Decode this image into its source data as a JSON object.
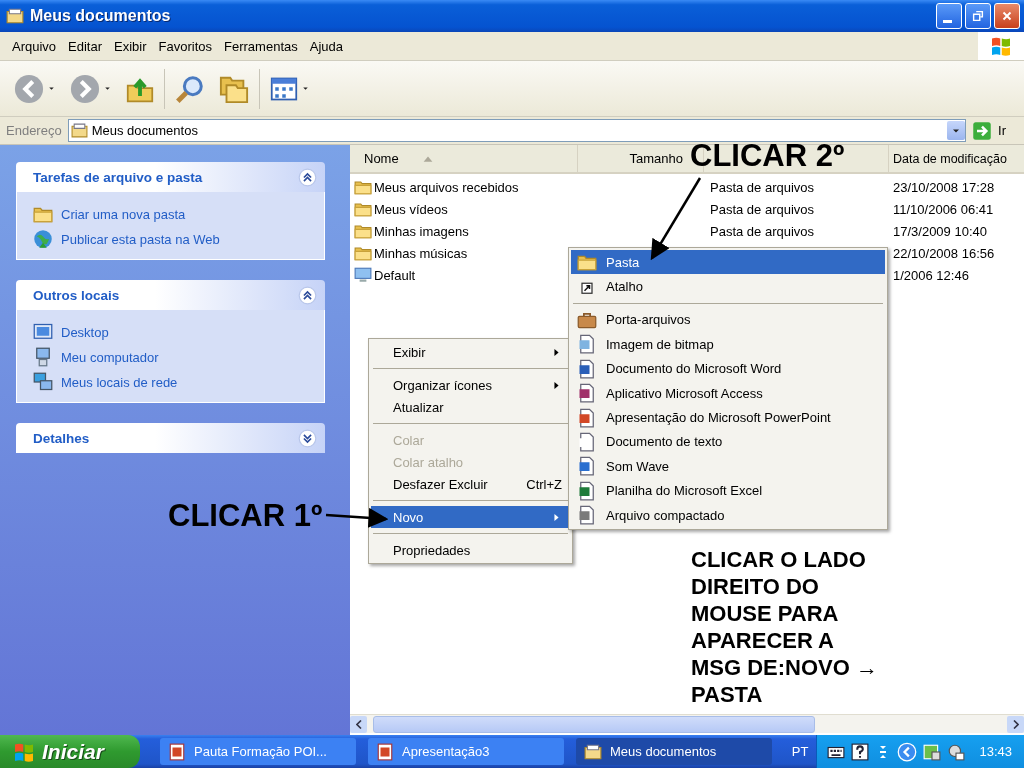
{
  "window": {
    "title": "Meus documentos"
  },
  "menu_bar": [
    "Arquivo",
    "Editar",
    "Exibir",
    "Favoritos",
    "Ferramentas",
    "Ajuda"
  ],
  "address_bar": {
    "label": "Endereço",
    "value": "Meus documentos",
    "go_button": "Ir"
  },
  "task_panes": [
    {
      "title": "Tarefas de arquivo e pasta",
      "expanded": true,
      "links": [
        "Criar uma nova pasta",
        "Publicar esta pasta na Web"
      ]
    },
    {
      "title": "Outros locais",
      "expanded": true,
      "links": [
        "Desktop",
        "Meu computador",
        "Meus locais de rede"
      ]
    },
    {
      "title": "Detalhes",
      "expanded": false
    }
  ],
  "file_list": {
    "columns": [
      {
        "label": "Nome",
        "sorted": true
      },
      {
        "label": "Tamanho",
        "sorted": false
      },
      {
        "label": "Data de modificação",
        "sorted": false
      }
    ],
    "rows": [
      {
        "name": "Meus arquivos recebidos",
        "type": "Pasta de arquivos",
        "modified": "23/10/2008 17:28"
      },
      {
        "name": "Meus vídeos",
        "type": "Pasta de arquivos",
        "modified": "11/10/2006 06:41"
      },
      {
        "name": "Minhas imagens",
        "type": "Pasta de arquivos",
        "modified": "17/3/2009 10:40"
      },
      {
        "name": "Minhas músicas",
        "modified": "22/10/2008 16:56"
      },
      {
        "name": "Default",
        "modified": "1/2006 12:46"
      }
    ]
  },
  "context_menu": [
    {
      "kind": "item",
      "label": "Exibir",
      "submenu": true,
      "disabled": false,
      "selected": false
    },
    {
      "kind": "separator"
    },
    {
      "kind": "item",
      "label": "Organizar ícones",
      "submenu": true,
      "disabled": false,
      "selected": false
    },
    {
      "kind": "item",
      "label": "Atualizar",
      "submenu": false,
      "disabled": false,
      "selected": false
    },
    {
      "kind": "separator"
    },
    {
      "kind": "item",
      "label": "Colar",
      "submenu": false,
      "disabled": true,
      "selected": false
    },
    {
      "kind": "item",
      "label": "Colar atalho",
      "submenu": false,
      "disabled": true,
      "selected": false
    },
    {
      "kind": "item",
      "label": "Desfazer Excluir",
      "shortcut": "Ctrl+Z",
      "submenu": false,
      "disabled": false,
      "selected": false
    },
    {
      "kind": "separator"
    },
    {
      "kind": "item",
      "label": "Novo",
      "submenu": true,
      "disabled": false,
      "selected": true
    },
    {
      "kind": "separator"
    },
    {
      "kind": "item",
      "label": "Propriedades",
      "submenu": false,
      "disabled": false,
      "selected": false
    }
  ],
  "new_submenu": [
    {
      "kind": "item",
      "label": "Pasta",
      "selected": true
    },
    {
      "kind": "item",
      "label": "Atalho",
      "selected": false
    },
    {
      "kind": "separator"
    },
    {
      "kind": "item",
      "label": "Porta-arquivos",
      "selected": false
    },
    {
      "kind": "item",
      "label": "Imagem de bitmap",
      "selected": false
    },
    {
      "kind": "item",
      "label": "Documento do Microsoft Word",
      "selected": false
    },
    {
      "kind": "item",
      "label": "Aplicativo Microsoft Access",
      "selected": false
    },
    {
      "kind": "item",
      "label": "Apresentação do Microsoft PowerPoint",
      "selected": false
    },
    {
      "kind": "item",
      "label": "Documento de texto",
      "selected": false
    },
    {
      "kind": "item",
      "label": "Som Wave",
      "selected": false
    },
    {
      "kind": "item",
      "label": "Planilha do Microsoft Excel",
      "selected": false
    },
    {
      "kind": "item",
      "label": "Arquivo compactado",
      "selected": false
    }
  ],
  "annotations": [
    {
      "text": "CLICAR 2º"
    },
    {
      "text": "CLICAR 1º"
    },
    {
      "text": "CLICAR O LADO\nDIREITO DO\nMOUSE PARA\nAPARECER A\nMSG DE:NOVO →\nPASTA"
    }
  ],
  "taskbar": {
    "start": "Iniciar",
    "tasks": [
      {
        "label": "Pauta Formação POI...",
        "selected": false
      },
      {
        "label": "Apresentação3",
        "selected": false
      },
      {
        "label": "Meus documentos",
        "selected": true
      }
    ],
    "language": "PT",
    "clock": "13:43"
  }
}
